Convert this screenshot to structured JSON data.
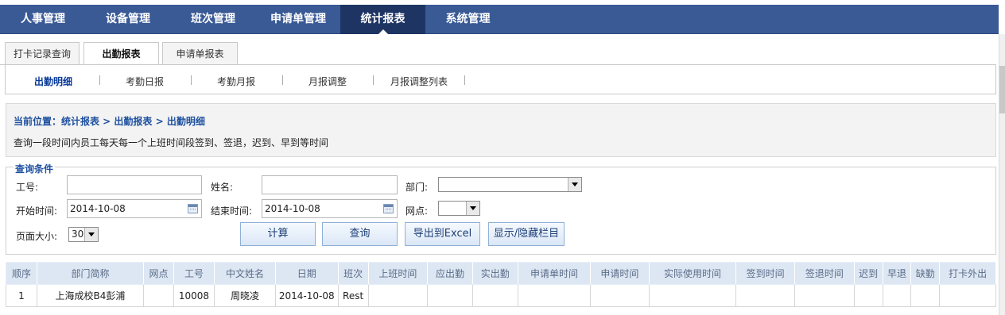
{
  "nav": {
    "items": [
      {
        "label": "人事管理"
      },
      {
        "label": "设备管理"
      },
      {
        "label": "班次管理"
      },
      {
        "label": "申请单管理"
      },
      {
        "label": "统计报表"
      },
      {
        "label": "系统管理"
      }
    ],
    "active": "统计报表"
  },
  "subtabs": [
    {
      "label": "打卡记录查询"
    },
    {
      "label": "出勤报表"
    },
    {
      "label": "申请单报表"
    }
  ],
  "links": [
    {
      "label": "出勤明细"
    },
    {
      "label": "考勤日报"
    },
    {
      "label": "考勤月报"
    },
    {
      "label": "月报调整"
    },
    {
      "label": "月报调整列表"
    }
  ],
  "location": "当前位置：统计报表 > 出勤报表 > 出勤明细",
  "description": "查询一段时间内员工每天每一个上班时间段签到、签退，迟到、早到等时间",
  "query": {
    "legend": "查询条件",
    "emp_no_label": "工号:",
    "emp_no_value": "",
    "name_label": "姓名:",
    "name_value": "",
    "dept_label": "部门:",
    "dept_value": "",
    "start_label": "开始时间:",
    "start_value": "2014-10-08",
    "end_label": "结束时间:",
    "end_value": "2014-10-08",
    "site_label": "网点:",
    "site_value": "",
    "pagesize_label": "页面大小:",
    "pagesize_value": "30",
    "btn_calc": "计算",
    "btn_query": "查询",
    "btn_export": "导出到Excel",
    "btn_columns": "显示/隐藏栏目"
  },
  "table": {
    "headers": [
      "顺序",
      "部门简称",
      "网点",
      "工号",
      "中文姓名",
      "日期",
      "班次",
      "上班时间",
      "应出勤",
      "实出勤",
      "申请单时间",
      "申请时间",
      "实际使用时间",
      "签到时间",
      "签退时间",
      "迟到",
      "早退",
      "缺勤",
      "打卡外出"
    ],
    "rows": [
      [
        "1",
        "上海成校B4彭浦",
        "",
        "10008",
        "周晓凌",
        "2014-10-08",
        "Rest",
        "",
        "",
        "",
        "",
        "",
        "",
        "",
        "",
        "",
        "",
        "",
        ""
      ]
    ]
  },
  "colors": {
    "nav_bg": "#3a5a96",
    "nav_active": "#1e3564",
    "link_active": "#0a3a9a",
    "location_text": "#1d4f9e",
    "table_header_bg": "#dde7f3"
  }
}
